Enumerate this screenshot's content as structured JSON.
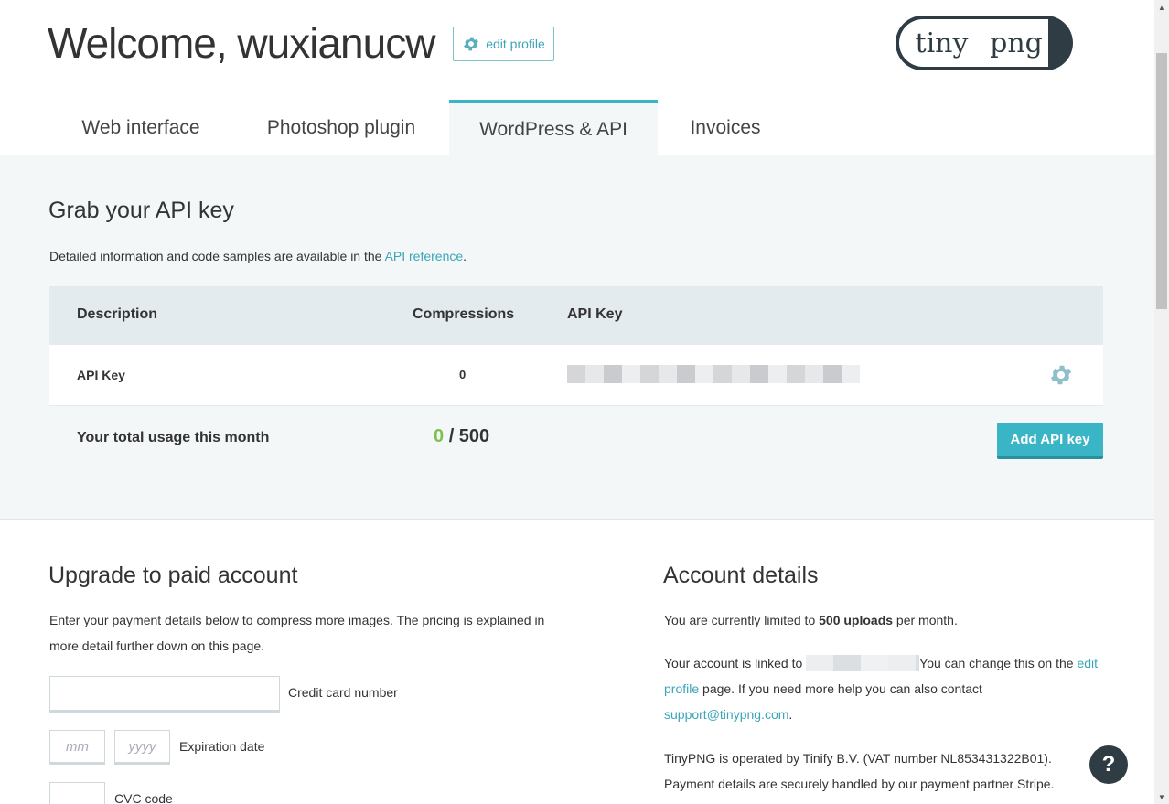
{
  "header": {
    "welcome": "Welcome, wuxianucw",
    "edit_profile": "edit profile",
    "logo_left": "tiny",
    "logo_right": "png"
  },
  "tabs": [
    {
      "label": "Web interface"
    },
    {
      "label": "Photoshop plugin"
    },
    {
      "label": "WordPress & API",
      "active": true
    },
    {
      "label": "Invoices"
    }
  ],
  "api": {
    "title": "Grab your API key",
    "desc_prefix": "Detailed information and code samples are available in the ",
    "desc_link": "API reference",
    "desc_suffix": ".",
    "columns": [
      "Description",
      "Compressions",
      "API Key"
    ],
    "rows": [
      {
        "description": "API Key",
        "compressions": "0"
      }
    ],
    "usage_label": "Your total usage this month",
    "usage_used": "0",
    "usage_total": "/ 500",
    "add_button": "Add API key"
  },
  "upgrade": {
    "title": "Upgrade to paid account",
    "desc": "Enter your payment details below to compress more images. The pricing is explained in more detail further down on this page.",
    "card_label": "Credit card number",
    "mm_placeholder": "mm",
    "yyyy_placeholder": "yyyy",
    "expiry_label": "Expiration date",
    "cvc_label": "CVC code"
  },
  "account": {
    "title": "Account details",
    "limit_prefix": "You are currently limited to ",
    "limit_bold": "500 uploads",
    "limit_suffix": " per month.",
    "linked_prefix": "Your account is linked to ",
    "linked_mid": "You can change this on the ",
    "edit_profile_link": "edit profile",
    "linked_suffix": " page. If you need more help you can also contact ",
    "support_email": "support@tinypng.com",
    "period": ".",
    "operator": "TinyPNG is operated by Tinify B.V. (VAT number NL853431322B01). Payment details are securely handled by our payment partner Stripe."
  },
  "help": "?",
  "colors": {
    "accent": "#3ab5c6",
    "link": "#3ba5b8",
    "dark": "#2f3c44",
    "green": "#7ec04a",
    "section_bg": "#f3f7f8"
  }
}
